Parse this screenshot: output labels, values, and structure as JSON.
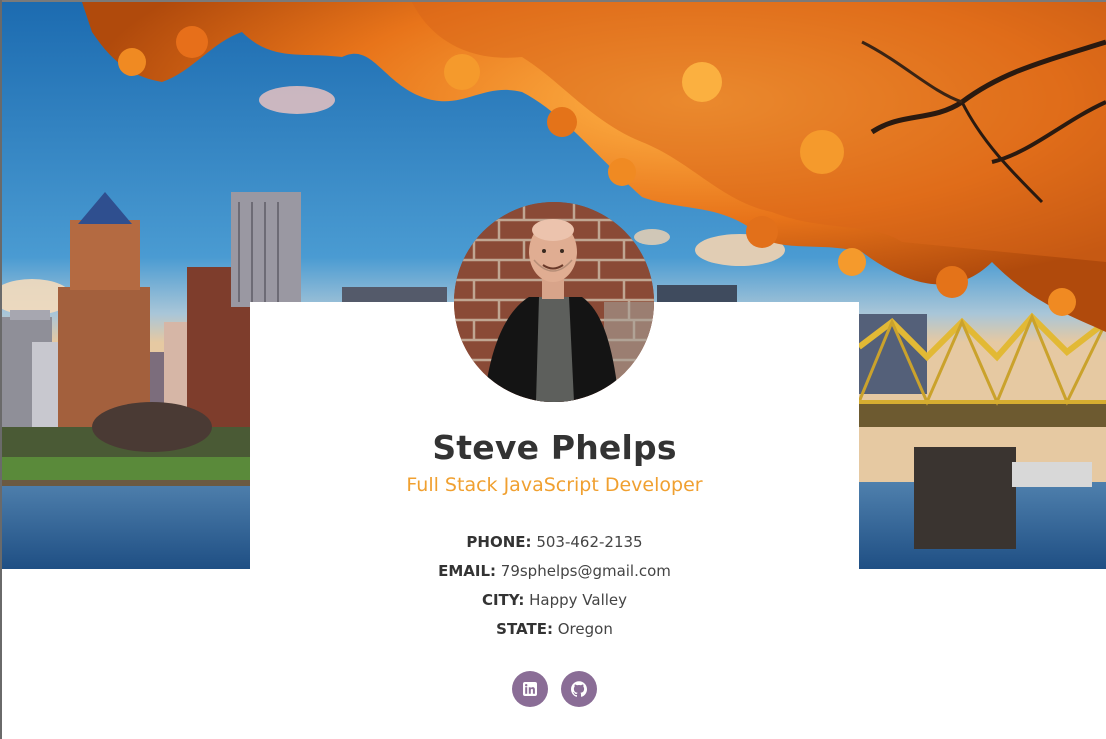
{
  "profile": {
    "name": "Steve Phelps",
    "title": "Full Stack JavaScript Developer"
  },
  "contact": {
    "phone_label": "PHONE:",
    "phone": "503-462-2135",
    "email_label": "EMAIL:",
    "email": "79sphelps@gmail.com",
    "city_label": "CITY:",
    "city": "Happy Valley",
    "state_label": "STATE:",
    "state": "Oregon"
  },
  "social": [
    {
      "icon": "linkedin-icon"
    },
    {
      "icon": "github-icon"
    }
  ],
  "colors": {
    "accent": "#f0a030",
    "social_button": "#8a6d96",
    "name_text": "#333333"
  }
}
